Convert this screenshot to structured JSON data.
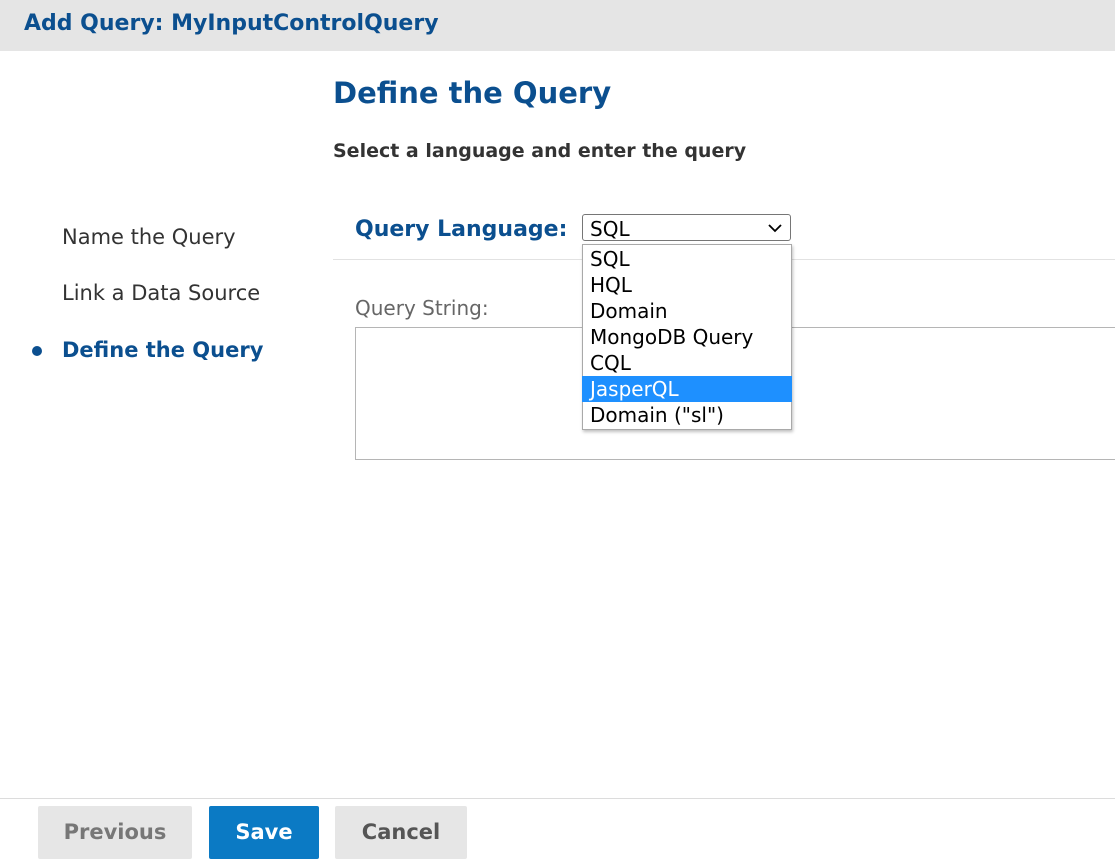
{
  "dialog": {
    "title": "Add Query: MyInputControlQuery"
  },
  "steps": [
    {
      "label": "Name the Query",
      "active": false
    },
    {
      "label": "Link a Data Source",
      "active": false
    },
    {
      "label": "Define the Query",
      "active": true
    }
  ],
  "main": {
    "heading": "Define the Query",
    "subheading": "Select a language and enter the query",
    "query_language": {
      "label": "Query Language:",
      "selected": "SQL",
      "options": [
        "SQL",
        "HQL",
        "Domain",
        "MongoDB Query",
        "CQL",
        "JasperQL",
        "Domain (\"sl\")"
      ],
      "highlighted": "JasperQL"
    },
    "query_string": {
      "label": "Query String:",
      "value": ""
    }
  },
  "buttons": {
    "previous": "Previous",
    "save": "Save",
    "cancel": "Cancel"
  },
  "colors": {
    "accent": "#0b4f8f",
    "primary_button": "#0b7ac4",
    "highlight": "#1e90ff"
  }
}
